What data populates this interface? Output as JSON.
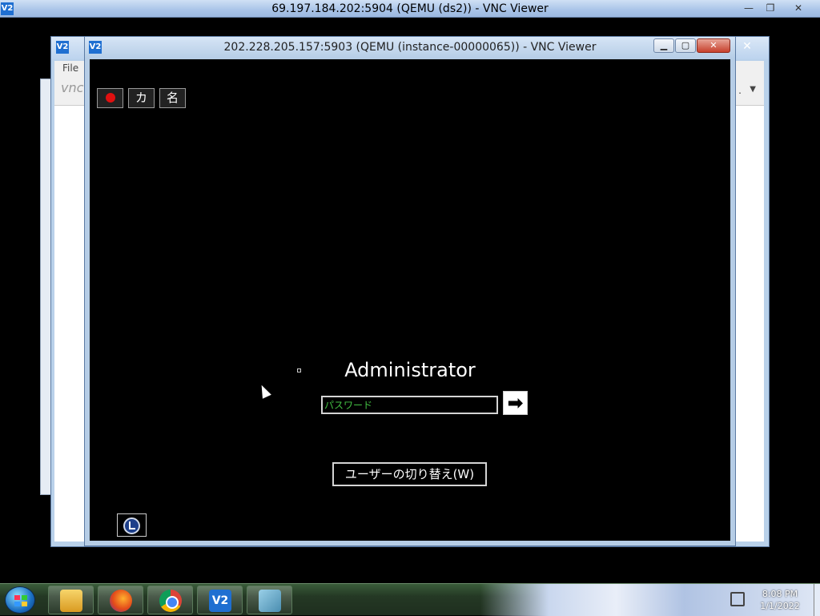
{
  "outer_window": {
    "title": "69.197.184.202:5904 (QEMU (ds2)) - VNC Viewer",
    "icon_label": "V2",
    "minimize": "—",
    "restore": "❐",
    "close": "✕"
  },
  "background_window": {
    "icon_label": "V2",
    "menu_file": "File",
    "logo_text": "vnc",
    "toolbar_dots": ".",
    "close": "✕"
  },
  "main_window": {
    "title": "202.228.205.157:5903 (QEMU (instance-00000065)) - VNC Viewer",
    "icon_label": "V2",
    "minimize": "▁",
    "maximize": "▢",
    "close": "✕"
  },
  "remote_screen": {
    "ime_button_2": "カ",
    "ime_button_3": "名",
    "username": "Administrator",
    "password_placeholder": "パスワード",
    "submit_arrow": "➡",
    "switch_user_label": "ユーザーの切り替え(W)"
  },
  "taskbar": {
    "vnc_label": "V2",
    "time": "8:08 PM",
    "date": "1/1/2022"
  }
}
